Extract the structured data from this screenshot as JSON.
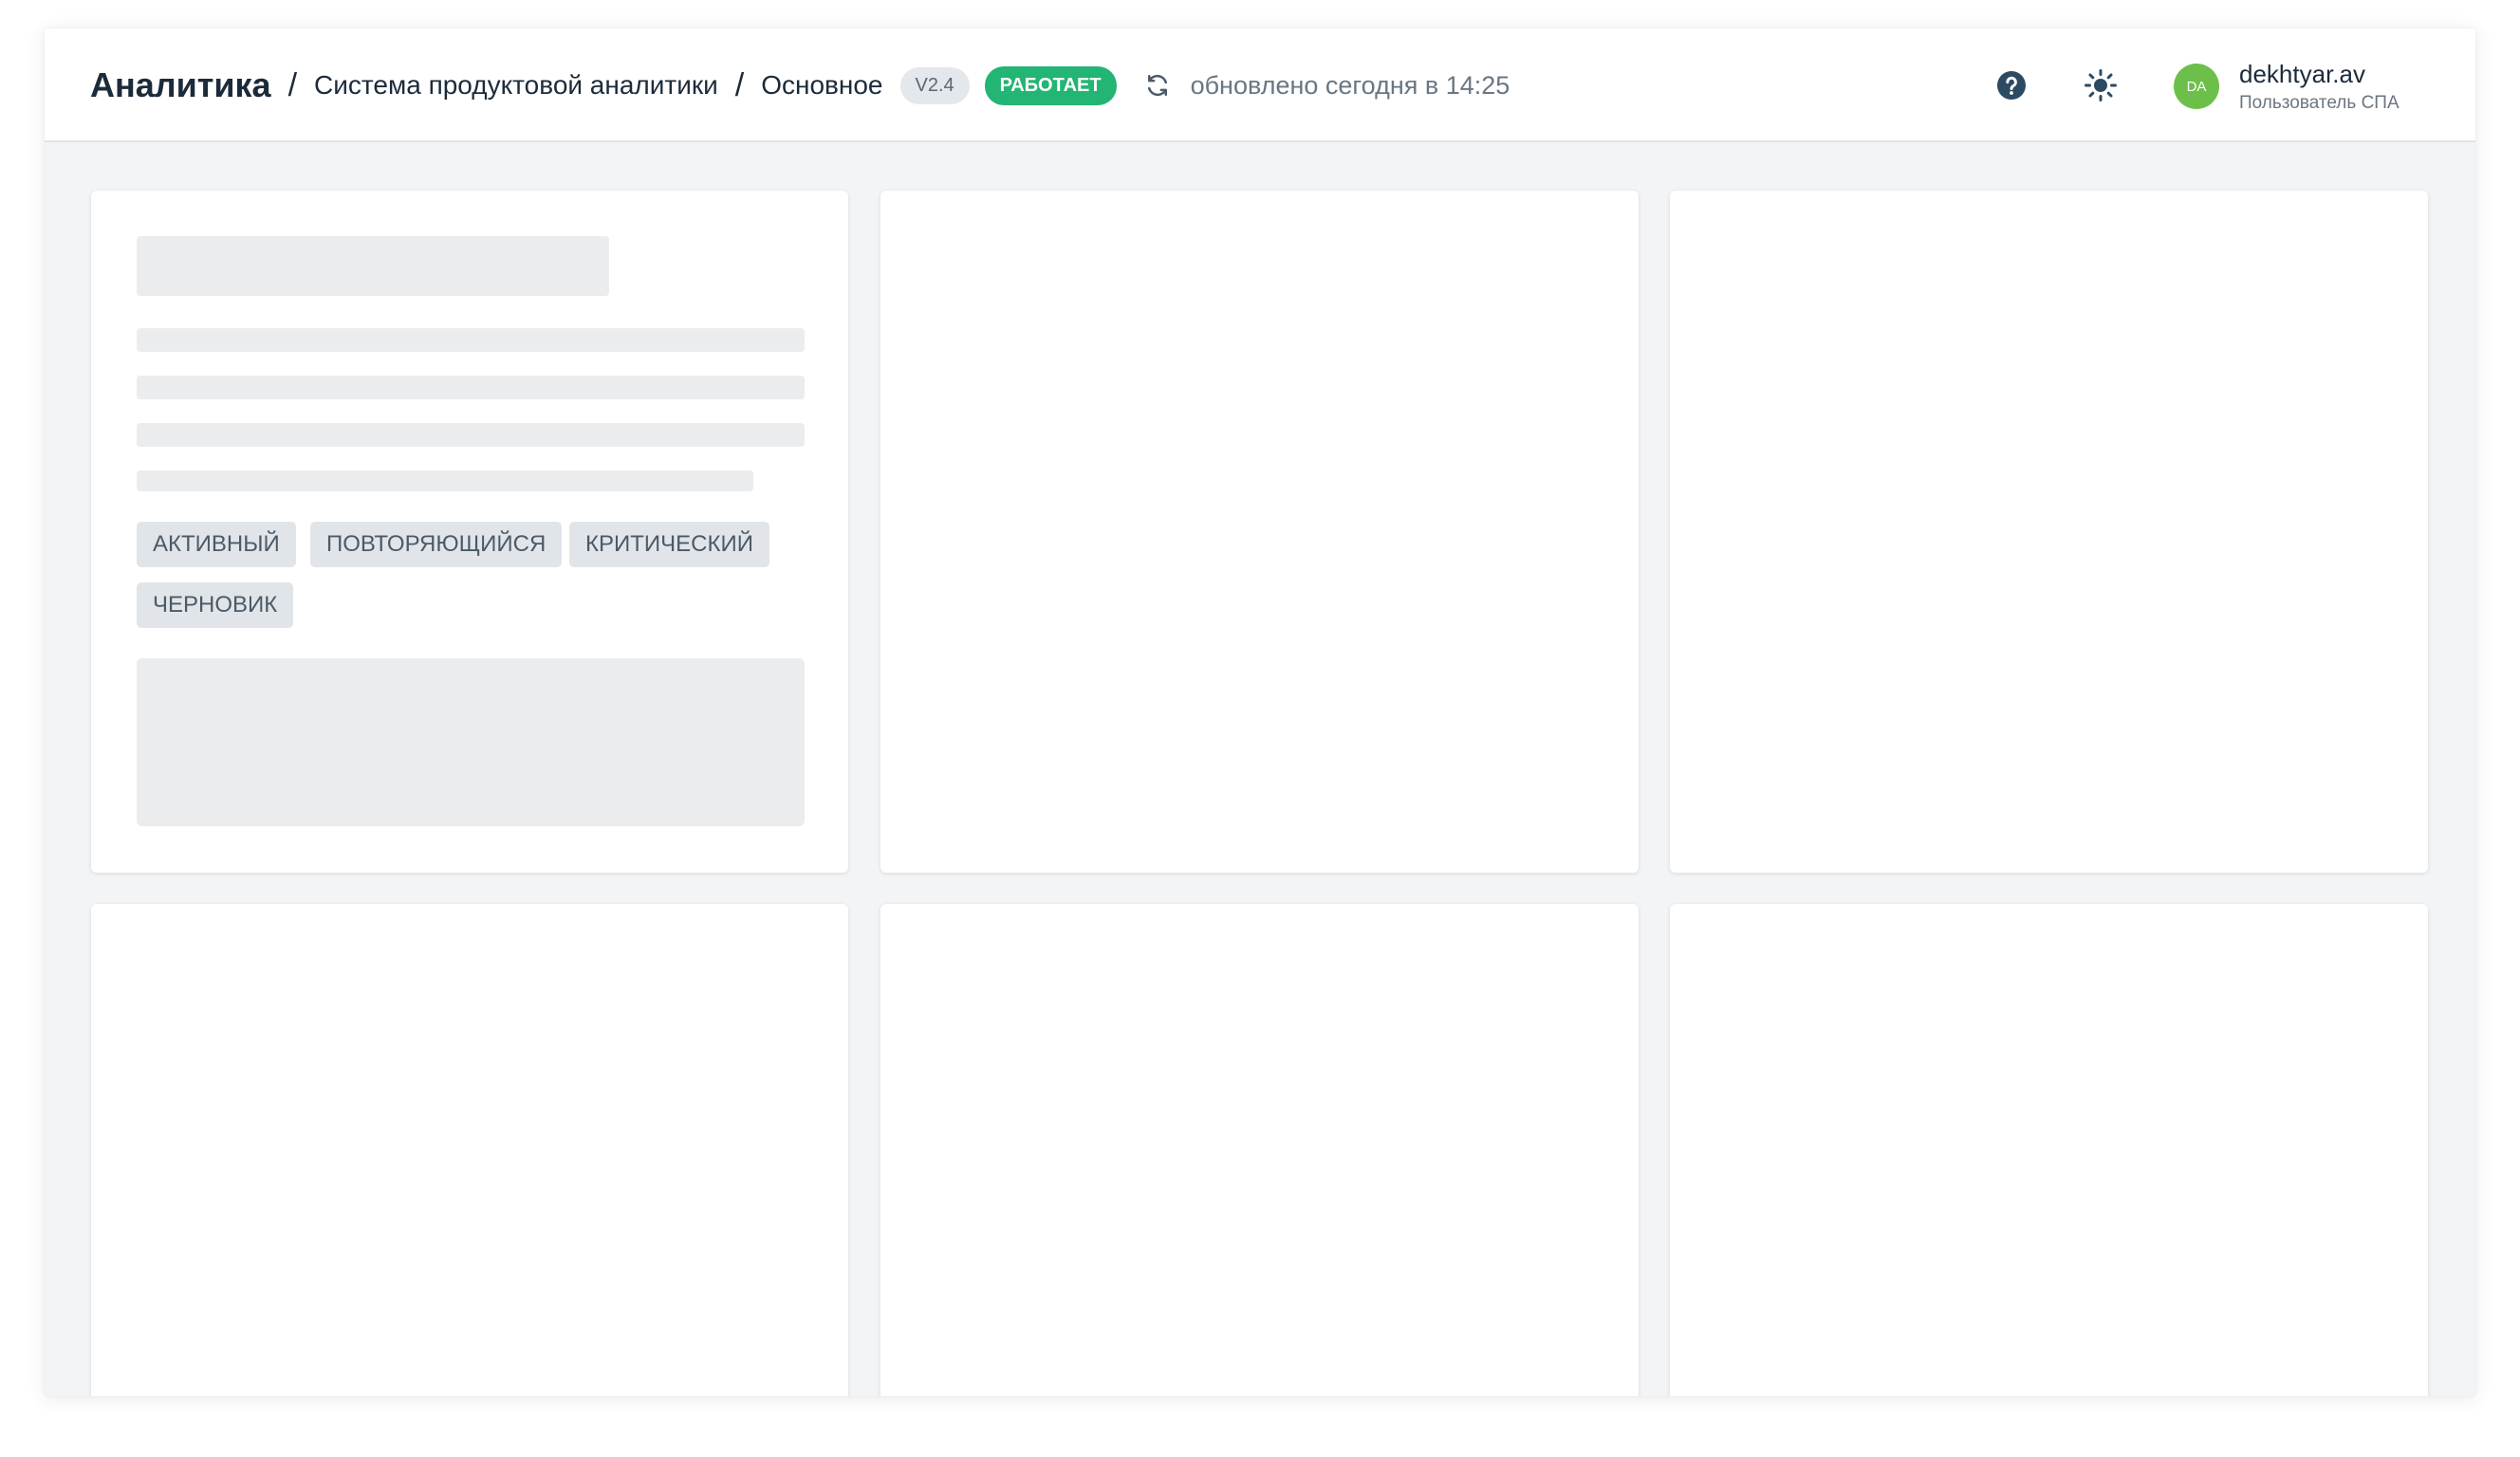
{
  "header": {
    "app_title": "Аналитика",
    "breadcrumb_separator": "/",
    "breadcrumbs": [
      "Система продуктовой аналитики",
      "Основное"
    ],
    "version": "V2.4",
    "status": "РАБОТАЕТ",
    "updated_text": "обновлено сегодня в 14:25",
    "icons": [
      "refresh-icon",
      "help-icon",
      "theme-sun-icon"
    ],
    "colors": {
      "accent_status": "#22b573",
      "avatar": "#6cc04a",
      "primary_text": "#1c2b3a"
    }
  },
  "user": {
    "initials": "DA",
    "name": "dekhtyar.av",
    "role": "Пользователь СПА"
  },
  "cards": {
    "first": {
      "tags": [
        "АКТИВНЫЙ",
        "ПОВТОРЯЮЩИЙСЯ",
        "КРИТИЧЕСКИЙ",
        "ЧЕРНОВИК"
      ]
    }
  }
}
